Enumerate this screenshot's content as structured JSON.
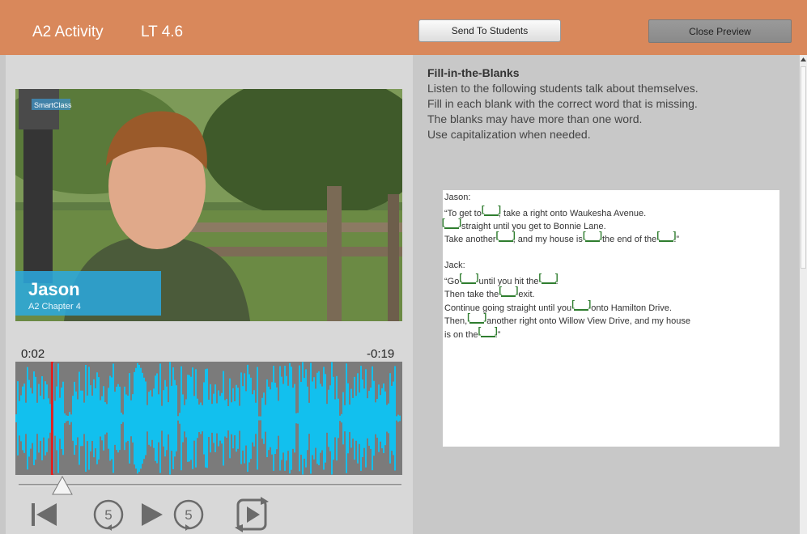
{
  "header": {
    "title": "A2 Activity",
    "lesson": "LT 4.6",
    "send_label": "Send To Students",
    "close_label": "Close Preview"
  },
  "video": {
    "brand": "SmartClass",
    "speaker_name": "Jason",
    "chapter": "A2 Chapter 4"
  },
  "player": {
    "elapsed": "0:02",
    "remaining": "-0:19",
    "progress": 0.095,
    "skip_back_seconds": "5",
    "skip_forward_seconds": "5"
  },
  "instructions": {
    "title": "Fill-in-the-Blanks",
    "lines": [
      "Listen to the following students talk about themselves.",
      "Fill in each blank with the correct word that is missing.",
      "The blanks may have more than one word.",
      "Use capitalization when needed."
    ]
  },
  "exercise": {
    "jason_label": "Jason:",
    "j1a": "“To get to ",
    "j1b": ", take a right onto Waukesha Avenue.",
    "j2b": " straight until you get to Bonnie Lane.",
    "j3a": "Take another ",
    "j3b": ", and my house is ",
    "j3c": " the end of the ",
    "j3d": ".”",
    "jack_label": "Jack:",
    "k1a": "“Go ",
    "k1b": " until you hit the ",
    "k1c": ".",
    "k2a": "Then take the ",
    "k2b": " exit.",
    "k3a": "Continue going straight until you ",
    "k3b": " onto Hamilton Drive.",
    "k4a": "Then, ",
    "k4b": " another right onto Willow View Drive, and my house",
    "k5a": "is on the ",
    "k5b": ".”"
  },
  "colors": {
    "header_bg": "#d9885b",
    "waveform": "#12c0ee",
    "playhead": "#e02020",
    "blank": "#2f7d2f"
  }
}
